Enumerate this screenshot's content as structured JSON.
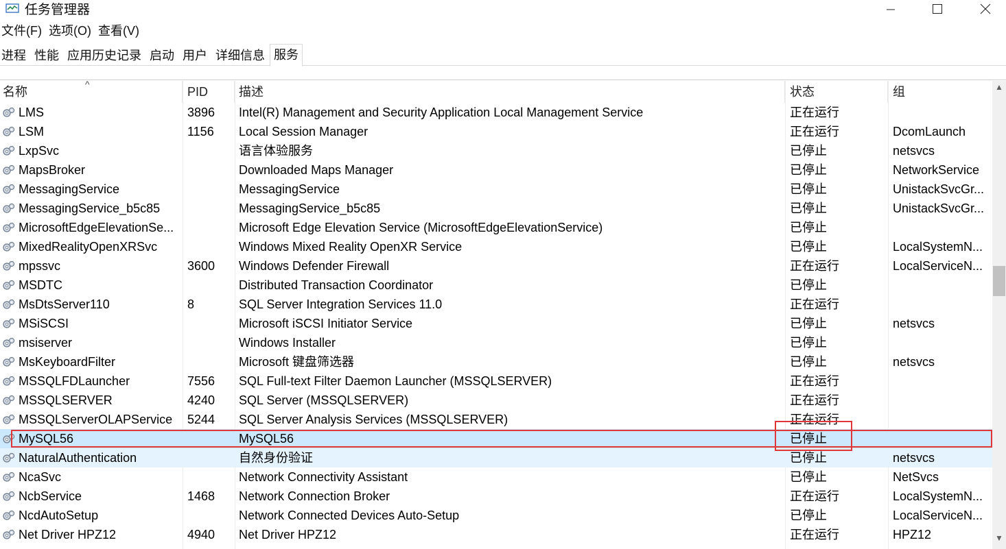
{
  "window": {
    "title": "任务管理器",
    "minimize_label": "—",
    "maximize_label": "☐",
    "close_label": "✕"
  },
  "menu": [
    "文件(F)",
    "选项(O)",
    "查看(V)"
  ],
  "tabs": [
    "进程",
    "性能",
    "应用历史记录",
    "启动",
    "用户",
    "详细信息",
    "服务"
  ],
  "active_tab": "服务",
  "columns": [
    "名称",
    "PID",
    "描述",
    "状态",
    "组"
  ],
  "sort_indicator": "^",
  "rows": [
    {
      "name": "LMS",
      "pid": "3896",
      "desc": "Intel(R) Management and Security Application Local Management Service",
      "status": "正在运行",
      "group": ""
    },
    {
      "name": "LSM",
      "pid": "1156",
      "desc": "Local Session Manager",
      "status": "正在运行",
      "group": "DcomLaunch"
    },
    {
      "name": "LxpSvc",
      "pid": "",
      "desc": "语言体验服务",
      "status": "已停止",
      "group": "netsvcs"
    },
    {
      "name": "MapsBroker",
      "pid": "",
      "desc": "Downloaded Maps Manager",
      "status": "已停止",
      "group": "NetworkService"
    },
    {
      "name": "MessagingService",
      "pid": "",
      "desc": "MessagingService",
      "status": "已停止",
      "group": "UnistackSvcGr..."
    },
    {
      "name": "MessagingService_b5c85",
      "pid": "",
      "desc": "MessagingService_b5c85",
      "status": "已停止",
      "group": "UnistackSvcGr..."
    },
    {
      "name": "MicrosoftEdgeElevationSe...",
      "pid": "",
      "desc": "Microsoft Edge Elevation Service (MicrosoftEdgeElevationService)",
      "status": "已停止",
      "group": ""
    },
    {
      "name": "MixedRealityOpenXRSvc",
      "pid": "",
      "desc": "Windows Mixed Reality OpenXR Service",
      "status": "已停止",
      "group": "LocalSystemN..."
    },
    {
      "name": "mpssvc",
      "pid": "3600",
      "desc": "Windows Defender Firewall",
      "status": "正在运行",
      "group": "LocalServiceN..."
    },
    {
      "name": "MSDTC",
      "pid": "",
      "desc": "Distributed Transaction Coordinator",
      "status": "已停止",
      "group": ""
    },
    {
      "name": "MsDtsServer110",
      "pid": "8",
      "desc": "SQL Server Integration Services 11.0",
      "status": "正在运行",
      "group": ""
    },
    {
      "name": "MSiSCSI",
      "pid": "",
      "desc": "Microsoft iSCSI Initiator Service",
      "status": "已停止",
      "group": "netsvcs"
    },
    {
      "name": "msiserver",
      "pid": "",
      "desc": "Windows Installer",
      "status": "已停止",
      "group": ""
    },
    {
      "name": "MsKeyboardFilter",
      "pid": "",
      "desc": "Microsoft 键盘筛选器",
      "status": "已停止",
      "group": "netsvcs"
    },
    {
      "name": "MSSQLFDLauncher",
      "pid": "7556",
      "desc": "SQL Full-text Filter Daemon Launcher (MSSQLSERVER)",
      "status": "正在运行",
      "group": ""
    },
    {
      "name": "MSSQLSERVER",
      "pid": "4240",
      "desc": "SQL Server (MSSQLSERVER)",
      "status": "正在运行",
      "group": ""
    },
    {
      "name": "MSSQLServerOLAPService",
      "pid": "5244",
      "desc": "SQL Server Analysis Services (MSSQLSERVER)",
      "status": "正在运行",
      "group": ""
    },
    {
      "name": "MySQL56",
      "pid": "",
      "desc": "MySQL56",
      "status": "已停止",
      "group": "",
      "state": "selected"
    },
    {
      "name": "NaturalAuthentication",
      "pid": "",
      "desc": "自然身份验证",
      "status": "已停止",
      "group": "netsvcs",
      "state": "hover"
    },
    {
      "name": "NcaSvc",
      "pid": "",
      "desc": "Network Connectivity Assistant",
      "status": "已停止",
      "group": "NetSvcs"
    },
    {
      "name": "NcbService",
      "pid": "1468",
      "desc": "Network Connection Broker",
      "status": "正在运行",
      "group": "LocalSystemN..."
    },
    {
      "name": "NcdAutoSetup",
      "pid": "",
      "desc": "Network Connected Devices Auto-Setup",
      "status": "已停止",
      "group": "LocalServiceN..."
    },
    {
      "name": "Net Driver HPZ12",
      "pid": "4940",
      "desc": "Net Driver HPZ12",
      "status": "正在运行",
      "group": "HPZ12"
    }
  ],
  "colors": {
    "selected_row": "#cce8ff",
    "hover_row": "#e5f3ff",
    "annotation_red": "#e0363a"
  }
}
